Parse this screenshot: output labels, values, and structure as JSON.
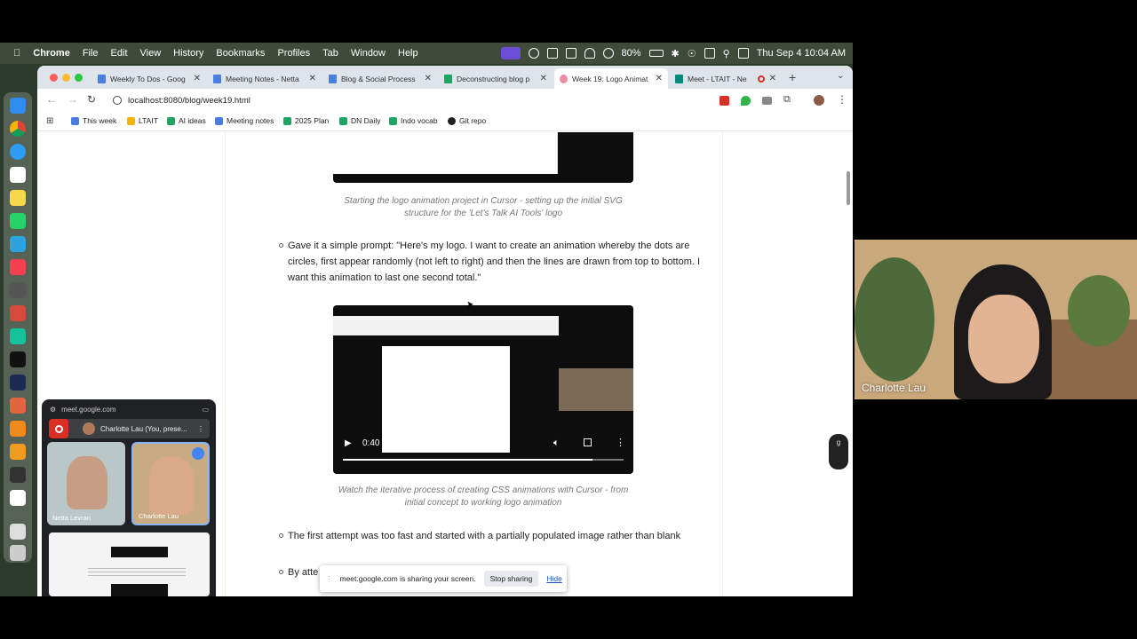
{
  "menubar": {
    "app": "Chrome",
    "items": [
      "File",
      "Edit",
      "View",
      "History",
      "Bookmarks",
      "Profiles",
      "Tab",
      "Window",
      "Help"
    ],
    "battery": "80%",
    "clock": "Thu Sep 4  10:04 AM"
  },
  "tabs": [
    {
      "label": "Weekly To Dos - Goog",
      "favicon": "docs-icon",
      "color": "#4a7fe0"
    },
    {
      "label": "Meeting Notes - Netta",
      "favicon": "docs-icon",
      "color": "#4a7fe0"
    },
    {
      "label": "Blog & Social Process",
      "favicon": "docs-icon",
      "color": "#4a7fe0"
    },
    {
      "label": "Deconstructing blog p",
      "favicon": "sheets-icon",
      "color": "#1fa463"
    },
    {
      "label": "Week 19: Logo Animat",
      "favicon": "brain-icon",
      "color": "#e88ea3",
      "active": true
    },
    {
      "label": "Meet - LTAIT - Ne",
      "favicon": "meet-icon",
      "color": "#00897b"
    }
  ],
  "address": "localhost:8080/blog/week19.html",
  "bookmarks": [
    {
      "label": "This week",
      "color": "#4a7fe0"
    },
    {
      "label": "LTAIT",
      "color": "#f4b400"
    },
    {
      "label": "AI ideas",
      "color": "#1fa463"
    },
    {
      "label": "Meeting notes",
      "color": "#4a7fe0"
    },
    {
      "label": "2025 Plan",
      "color": "#1fa463"
    },
    {
      "label": "DN Daily",
      "color": "#1fa463"
    },
    {
      "label": "Indo vocab",
      "color": "#1fa463"
    },
    {
      "label": "Git repo",
      "color": "#222222"
    }
  ],
  "article": {
    "caption1": "Starting the logo animation project in Cursor - setting up the initial SVG structure for the 'Let's Talk AI Tools' logo",
    "bullet1": "Gave it a simple prompt: \"Here's my logo. I want to create an animation whereby the dots are circles, first appear randomly (not left to right) and then the lines are drawn from top to bottom. I want this animation to last one second total.\"",
    "video_time": "0:40 / 0:45",
    "video_progress": 0.889,
    "caption2": "Watch the iterative process of creating CSS animations with Cursor - from initial concept to working logo animation",
    "bullet2": "The first attempt was too fast and started with a partially populated image rather than blank",
    "bullet3": "By atte"
  },
  "sharebar": {
    "message": "meet.google.com is sharing your screen.",
    "stop_label": "Stop sharing",
    "hide_label": "Hide"
  },
  "pip": {
    "url": "meet.google.com",
    "presenting": "Charlotte Lau (You, prese...",
    "participant1": "Netta Levran",
    "participant2": "Charlotte Lau"
  },
  "camera": {
    "name": "Charlotte Lau"
  },
  "side_badge": "g"
}
